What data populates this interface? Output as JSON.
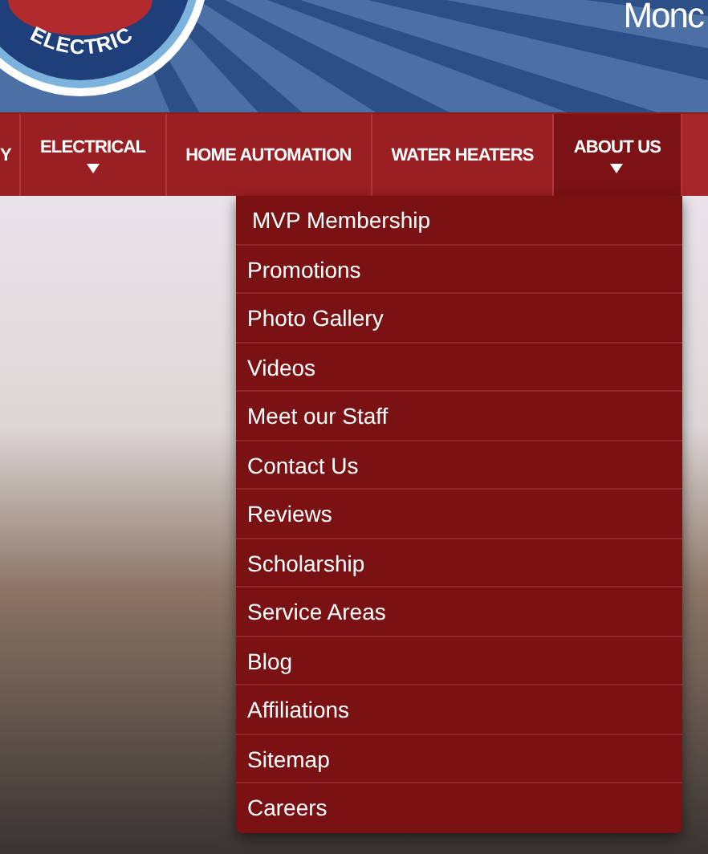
{
  "header": {
    "logo_text": "ELECTRIC",
    "tagline": "Monc"
  },
  "nav": [
    {
      "label": "Y",
      "has_submenu": false,
      "selected": false
    },
    {
      "label": "ELECTRICAL",
      "has_submenu": true,
      "selected": false
    },
    {
      "label": "HOME AUTOMATION",
      "has_submenu": false,
      "selected": false
    },
    {
      "label": "WATER HEATERS",
      "has_submenu": false,
      "selected": false
    },
    {
      "label": "ABOUT US",
      "has_submenu": true,
      "selected": true
    }
  ],
  "dropdown": [
    {
      "label": "MVP Membership",
      "hovered": true
    },
    {
      "label": "Promotions",
      "hovered": false
    },
    {
      "label": "Photo Gallery",
      "hovered": false
    },
    {
      "label": "Videos",
      "hovered": false
    },
    {
      "label": "Meet our Staff",
      "hovered": false
    },
    {
      "label": "Contact Us",
      "hovered": false
    },
    {
      "label": "Reviews",
      "hovered": false
    },
    {
      "label": "Scholarship",
      "hovered": false
    },
    {
      "label": "Service Areas",
      "hovered": false
    },
    {
      "label": "Blog",
      "hovered": false
    },
    {
      "label": "Affiliations",
      "hovered": false
    },
    {
      "label": "Sitemap",
      "hovered": false
    },
    {
      "label": "Careers",
      "hovered": false
    }
  ]
}
